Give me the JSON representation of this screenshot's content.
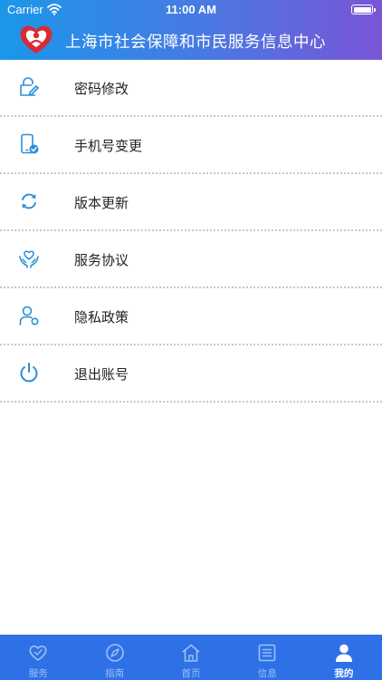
{
  "status_bar": {
    "carrier": "Carrier",
    "time": "11:00 AM"
  },
  "header": {
    "title": "上海市社会保障和市民服务信息中心",
    "logo": "heart-logo-icon"
  },
  "menu": {
    "items": [
      {
        "label": "密码修改",
        "icon": "password-edit-icon"
      },
      {
        "label": "手机号变更",
        "icon": "phone-change-icon"
      },
      {
        "label": "版本更新",
        "icon": "refresh-icon"
      },
      {
        "label": "服务协议",
        "icon": "heart-hands-icon"
      },
      {
        "label": "隐私政策",
        "icon": "person-icon"
      },
      {
        "label": "退出账号",
        "icon": "power-icon"
      }
    ],
    "icon_color": "#2a8fd8"
  },
  "tabbar": {
    "items": [
      {
        "label": "服务",
        "icon": "heart-icon"
      },
      {
        "label": "指南",
        "icon": "compass-icon"
      },
      {
        "label": "首页",
        "icon": "home-icon"
      },
      {
        "label": "信息",
        "icon": "list-icon"
      },
      {
        "label": "我的",
        "icon": "user-icon",
        "active": true
      }
    ],
    "background": "#2e71e6"
  }
}
